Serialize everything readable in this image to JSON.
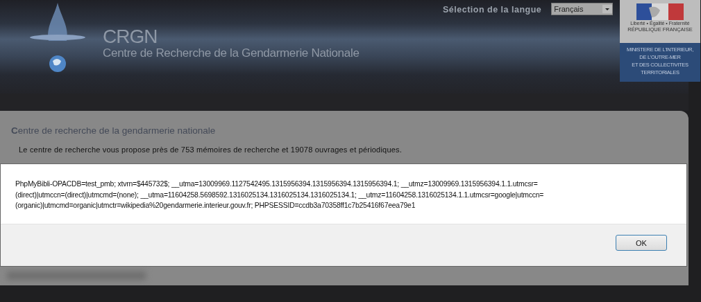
{
  "header": {
    "logo_title": "CRGN",
    "logo_subtitle": "Centre de Recherche de la Gendarmerie Nationale",
    "language_label": "Sélection de la langue",
    "language_select": {
      "value": "Français"
    },
    "ministry_badge": {
      "motto": "Liberté • Égalité • Fraternité",
      "republic": "RÉPUBLIQUE FRANÇAISE",
      "ministry_lines": [
        "MINISTERE DE L'INTERIEUR,",
        "DE L'OUTRE-MER",
        "ET DES COLLECTIVITES",
        "TERRITORIALES"
      ]
    }
  },
  "content": {
    "title": "**C**entre de recherche de la gendarmerie nationale",
    "intro": "Le centre de recherche vous propose près de 753 mémoires de recherche et 19078 ouvrages et périodiques."
  },
  "dialog": {
    "message_lines": [
      "PhpMyBibli-OPACDB=test_pmb; xtvrn=$445732$; __utma=13009969.1127542495.1315956394.1315956394.1315956394.1; __utmz=13009969.1315956394.1.1.utmcsr=",
      "(direct)|utmccn=(direct)|utmcmd=(none); __utma=11604258.5698592.1316025134.1316025134.1316025134.1; __utmz=11604258.1316025134.1.1.utmcsr=google|utmccn=",
      "(organic)|utmcmd=organic|utmctr=wikipedia%20gendarmerie.interieur.gouv.fr; PHPSESSID=ccdb3a70358ff1c7b25416f67eea79e1"
    ],
    "buttons": [
      "OK"
    ]
  }
}
